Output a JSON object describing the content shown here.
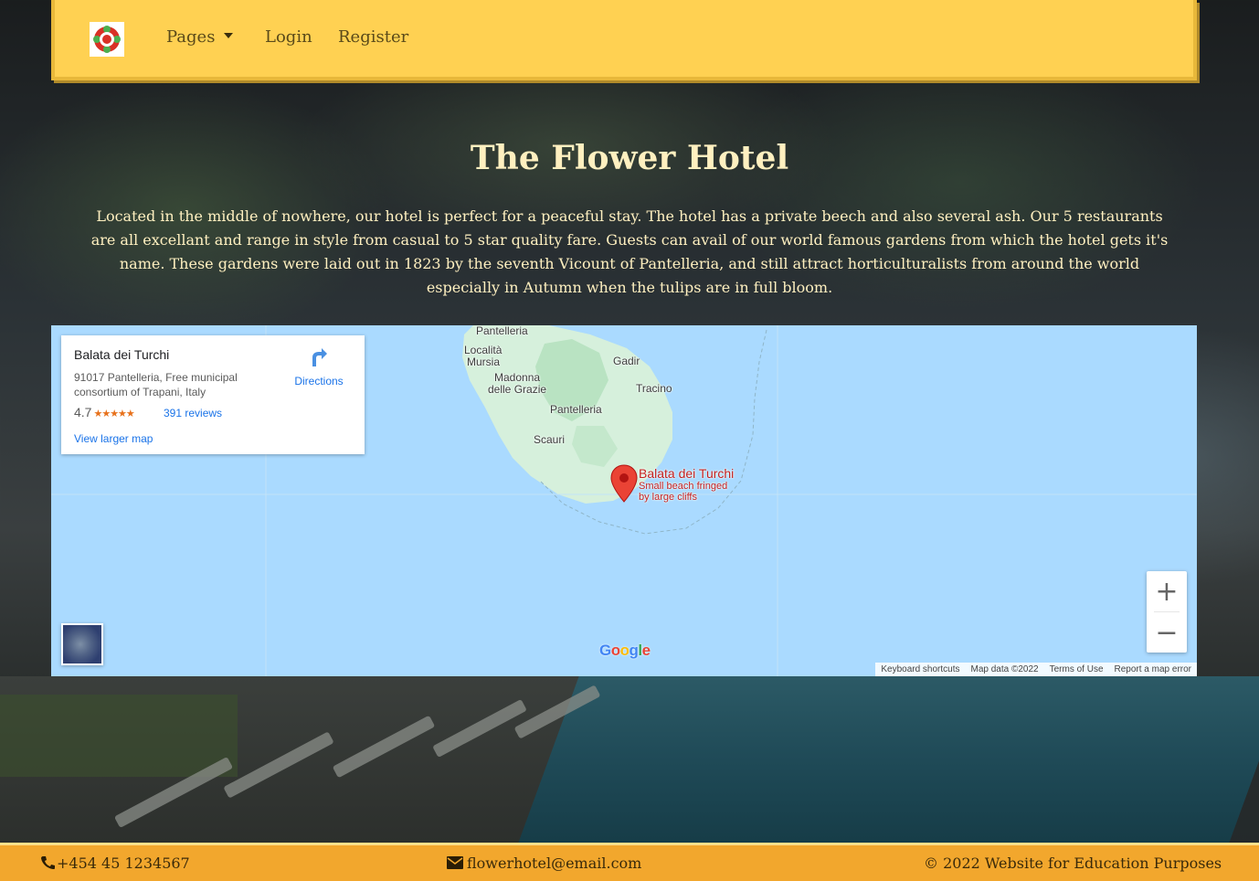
{
  "nav": {
    "pages_label": "Pages",
    "login_label": "Login",
    "register_label": "Register"
  },
  "hero": {
    "title": "The Flower Hotel",
    "text": "Located in the middle of nowhere, our hotel is perfect for a peaceful stay. The hotel has a private beech and also several ash. Our 5 restaurants are all excellant and range in style from casual to 5 star quality fare. Guests can avail of our world famous gardens from which the hotel gets it's name. These gardens were laid out in 1823 by the seventh Vicount of Pantelleria, and still attract horticulturalists from around the world especially in Autumn when the tulips are in full bloom."
  },
  "map": {
    "card": {
      "title": "Balata dei Turchi",
      "address": "91017 Pantelleria, Free municipal consortium of Trapani, Italy",
      "rating": "4.7",
      "stars": "★★★★★",
      "reviews": "391 reviews",
      "directions": "Directions",
      "larger_map": "View larger map"
    },
    "places": {
      "pantelleria_top": "Pantelleria",
      "localita": "Località",
      "mursia": "Mursia",
      "madonna": "Madonna",
      "delle_grazie": "delle Grazie",
      "gadir": "Gadir",
      "tracino": "Tracino",
      "pantelleria_center": "Pantelleria",
      "scauri": "Scauri"
    },
    "pin": {
      "name": "Balata dei Turchi",
      "desc1": "Small beach fringed",
      "desc2": "by large cliffs"
    },
    "zoom_in": "+",
    "zoom_out": "−",
    "google_logo": [
      "G",
      "o",
      "o",
      "g",
      "l",
      "e"
    ],
    "google_colors": [
      "#4285f4",
      "#ea4335",
      "#fbbc05",
      "#4285f4",
      "#34a853",
      "#ea4335"
    ],
    "footer": {
      "shortcuts": "Keyboard shortcuts",
      "map_data": "Map data ©2022",
      "terms": "Terms of Use",
      "report": "Report a map error"
    }
  },
  "footer": {
    "phone": "+454 45 1234567",
    "email": "flowerhotel@email.com",
    "copyright": "© 2022 Website for Education Purposes"
  },
  "colors": {
    "nav_bg": "#ffd152",
    "footer_bg": "#f2a72d",
    "hero_text": "#fff0c0",
    "map_water": "#aadaff",
    "pin": "#ea4335"
  }
}
